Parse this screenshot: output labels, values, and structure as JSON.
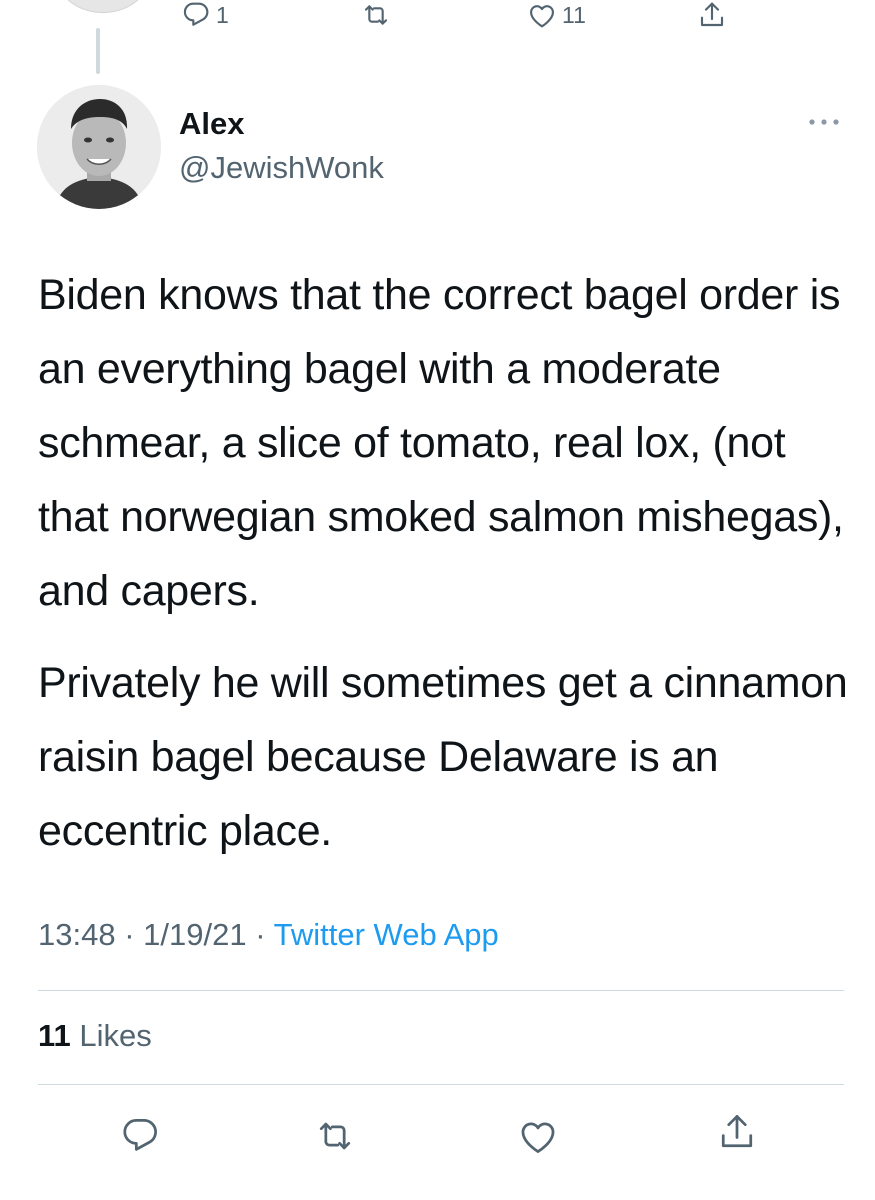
{
  "previous_tweet": {
    "reply_count": "1",
    "like_count": "11"
  },
  "tweet": {
    "author": {
      "name": "Alex",
      "handle": "@JewishWonk"
    },
    "paragraphs": [
      "Biden knows that the correct bagel order is an everything bagel with a moderate schmear, a slice of tomato, real lox, (not that norwegian smoked salmon mishegas), and capers.",
      "Privately he will sometimes get a cinnamon raisin bagel because Delaware is an eccentric place."
    ],
    "time": "13:48",
    "date": "1/19/21",
    "separator": "·",
    "source": "Twitter Web App",
    "likes": {
      "count": "11",
      "label": "Likes"
    }
  },
  "icons": {
    "reply": "reply-icon",
    "retweet": "retweet-icon",
    "like": "heart-icon",
    "share": "share-icon",
    "more": "more-icon"
  },
  "colors": {
    "text_primary": "#0f1419",
    "text_secondary": "#536471",
    "link": "#1d9bf0",
    "divider": "#cfd9de"
  }
}
